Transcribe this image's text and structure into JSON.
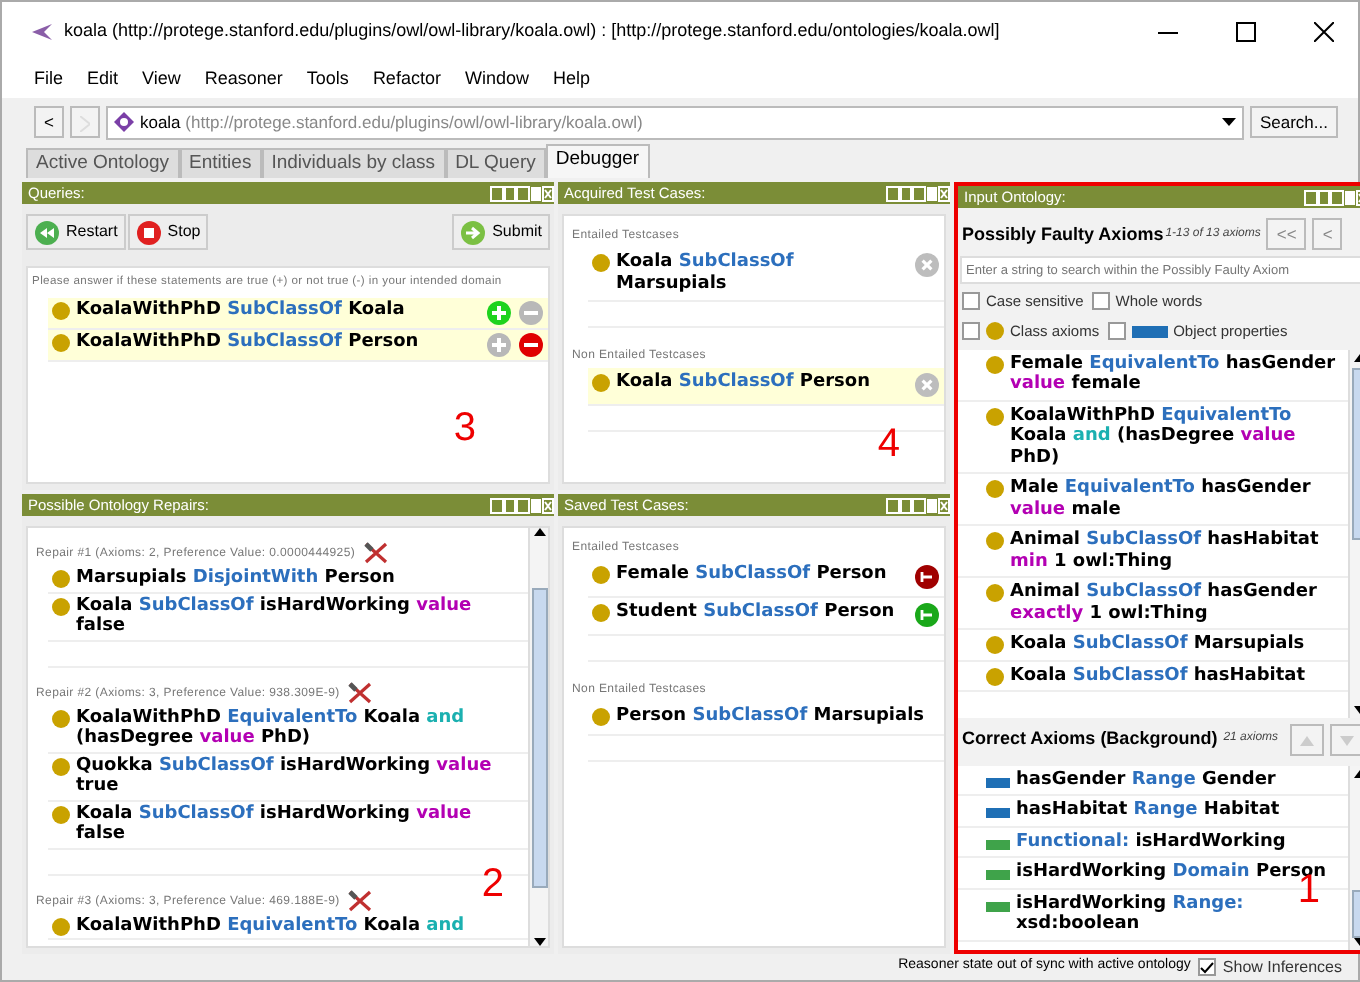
{
  "window": {
    "title": "koala (http://protege.stanford.edu/plugins/owl/owl-library/koala.owl)  : [http://protege.stanford.edu/ontologies/koala.owl]"
  },
  "menu": [
    "File",
    "Edit",
    "View",
    "Reasoner",
    "Tools",
    "Refactor",
    "Window",
    "Help"
  ],
  "address_bar": {
    "back": "<",
    "name": "koala",
    "iri": "(http://protege.stanford.edu/plugins/owl/owl-library/koala.owl)",
    "search_button": "Search..."
  },
  "tabs": [
    {
      "label": "Active Ontology",
      "selected": false
    },
    {
      "label": "Entities",
      "selected": false
    },
    {
      "label": "Individuals by class",
      "selected": false
    },
    {
      "label": "DL Query",
      "selected": false
    },
    {
      "label": "Debugger",
      "selected": true
    }
  ],
  "queries": {
    "title": "Queries:",
    "restart": "Restart",
    "stop": "Stop",
    "submit": "Submit",
    "instruction": "Please answer if these statements are true (+) or not true (-) in your intended domain",
    "annotation": "3",
    "items": [
      {
        "plus_on": true,
        "minus_on": false,
        "tokens": [
          {
            "text": "KoalaWithPhD",
            "kind": "name"
          },
          {
            "text": "SubClassOf",
            "kind": "keyword"
          },
          {
            "text": "Koala",
            "kind": "name"
          }
        ]
      },
      {
        "plus_on": false,
        "minus_on": true,
        "tokens": [
          {
            "text": "KoalaWithPhD",
            "kind": "name"
          },
          {
            "text": "SubClassOf",
            "kind": "keyword"
          },
          {
            "text": "Person",
            "kind": "name"
          }
        ]
      }
    ]
  },
  "repairs": {
    "title": "Possible Ontology Repairs:",
    "annotation": "2",
    "items": [
      {
        "header": "Repair #1 (Axioms: 2, Preference Value: 0.0000444925)",
        "axioms": [
          [
            {
              "text": "Marsupials",
              "kind": "name"
            },
            {
              "text": "DisjointWith",
              "kind": "keyword"
            },
            {
              "text": "Person",
              "kind": "name"
            }
          ],
          [
            {
              "text": "Koala",
              "kind": "name"
            },
            {
              "text": "SubClassOf",
              "kind": "keyword"
            },
            {
              "text": "isHardWorking",
              "kind": "name"
            },
            {
              "text": "value",
              "kind": "restriction"
            },
            {
              "text": "false",
              "kind": "name"
            }
          ]
        ]
      },
      {
        "header": "Repair #2 (Axioms: 3, Preference Value: 938.309E-9)",
        "axioms": [
          [
            {
              "text": "KoalaWithPhD",
              "kind": "name"
            },
            {
              "text": "EquivalentTo",
              "kind": "keyword"
            },
            {
              "text": "Koala",
              "kind": "name"
            },
            {
              "text": "and",
              "kind": "connective"
            },
            {
              "text": "(hasDegree",
              "kind": "name"
            },
            {
              "text": "value",
              "kind": "restriction"
            },
            {
              "text": "PhD)",
              "kind": "name"
            }
          ],
          [
            {
              "text": "Quokka",
              "kind": "name"
            },
            {
              "text": "SubClassOf",
              "kind": "keyword"
            },
            {
              "text": "isHardWorking",
              "kind": "name"
            },
            {
              "text": "value",
              "kind": "restriction"
            },
            {
              "text": "true",
              "kind": "name"
            }
          ],
          [
            {
              "text": "Koala",
              "kind": "name"
            },
            {
              "text": "SubClassOf",
              "kind": "keyword"
            },
            {
              "text": "isHardWorking",
              "kind": "name"
            },
            {
              "text": "value",
              "kind": "restriction"
            },
            {
              "text": "false",
              "kind": "name"
            }
          ]
        ]
      },
      {
        "header": "Repair #3 (Axioms: 3, Preference Value: 469.188E-9)",
        "axioms": [
          [
            {
              "text": "KoalaWithPhD",
              "kind": "name"
            },
            {
              "text": "EquivalentTo",
              "kind": "keyword"
            },
            {
              "text": "Koala",
              "kind": "name"
            },
            {
              "text": "and",
              "kind": "connective"
            }
          ]
        ]
      }
    ]
  },
  "acquired": {
    "title": "Acquired Test Cases:",
    "annotation": "4",
    "sections": [
      {
        "heading": "Entailed Testcases",
        "items": [
          {
            "highlighted": false,
            "tokens": [
              {
                "text": "Koala",
                "kind": "name"
              },
              {
                "text": "SubClassOf",
                "kind": "keyword"
              },
              {
                "text": "Marsupials",
                "kind": "name"
              }
            ]
          }
        ]
      },
      {
        "heading": "Non Entailed Testcases",
        "items": [
          {
            "highlighted": true,
            "tokens": [
              {
                "text": "Koala",
                "kind": "name"
              },
              {
                "text": "SubClassOf",
                "kind": "keyword"
              },
              {
                "text": "Person",
                "kind": "name"
              }
            ]
          }
        ]
      }
    ]
  },
  "saved": {
    "title": "Saved Test Cases:",
    "sections": [
      {
        "heading": "Entailed Testcases",
        "items": [
          {
            "color": "#a00000",
            "tokens": [
              {
                "text": "Female",
                "kind": "name"
              },
              {
                "text": "SubClassOf",
                "kind": "keyword"
              },
              {
                "text": "Person",
                "kind": "name"
              }
            ]
          },
          {
            "color": "#1aa81a",
            "tokens": [
              {
                "text": "Student",
                "kind": "name"
              },
              {
                "text": "SubClassOf",
                "kind": "keyword"
              },
              {
                "text": "Person",
                "kind": "name"
              }
            ]
          }
        ]
      },
      {
        "heading": "Non Entailed Testcases",
        "items": [
          {
            "tokens": [
              {
                "text": "Person",
                "kind": "name"
              },
              {
                "text": "SubClassOf",
                "kind": "keyword"
              },
              {
                "text": "Marsupials",
                "kind": "name"
              }
            ]
          }
        ]
      }
    ]
  },
  "input_ontology": {
    "title": "Input Ontology:",
    "annotation": "1",
    "faulty": {
      "title": "Possibly Faulty Axioms",
      "count": "1-13 of 13 axioms",
      "nav": [
        "<<",
        "<"
      ],
      "search_placeholder": "Enter a string to search within the Possibly Faulty Axiom",
      "options": [
        {
          "label": "Case sensitive",
          "checked": false
        },
        {
          "label": "Whole words",
          "checked": false
        }
      ],
      "filters": [
        {
          "label": "Class axioms",
          "checked": false,
          "kind": "class"
        },
        {
          "label": "Object properties",
          "checked": false,
          "kind": "object-property"
        }
      ],
      "axioms": [
        {
          "kind": "class",
          "tokens": [
            {
              "text": "Female",
              "kind": "name"
            },
            {
              "text": "EquivalentTo",
              "kind": "keyword"
            },
            {
              "text": "hasGender",
              "kind": "name"
            },
            {
              "text": "value",
              "kind": "restriction"
            },
            {
              "text": "female",
              "kind": "name"
            }
          ]
        },
        {
          "kind": "class",
          "tokens": [
            {
              "text": "KoalaWithPhD",
              "kind": "name"
            },
            {
              "text": "EquivalentTo",
              "kind": "keyword"
            },
            {
              "text": "Koala",
              "kind": "name"
            },
            {
              "text": "and",
              "kind": "connective"
            },
            {
              "text": "(hasDegree",
              "kind": "name"
            },
            {
              "text": "value",
              "kind": "restriction"
            },
            {
              "text": "PhD)",
              "kind": "name"
            }
          ]
        },
        {
          "kind": "class",
          "tokens": [
            {
              "text": "Male",
              "kind": "name"
            },
            {
              "text": "EquivalentTo",
              "kind": "keyword"
            },
            {
              "text": "hasGender",
              "kind": "name"
            },
            {
              "text": "value",
              "kind": "restriction"
            },
            {
              "text": "male",
              "kind": "name"
            }
          ]
        },
        {
          "kind": "class",
          "tokens": [
            {
              "text": "Animal",
              "kind": "name"
            },
            {
              "text": "SubClassOf",
              "kind": "keyword"
            },
            {
              "text": "hasHabitat",
              "kind": "name"
            },
            {
              "text": "min",
              "kind": "restriction"
            },
            {
              "text": "1 owl:Thing",
              "kind": "name"
            }
          ]
        },
        {
          "kind": "class",
          "tokens": [
            {
              "text": "Animal",
              "kind": "name"
            },
            {
              "text": "SubClassOf",
              "kind": "keyword"
            },
            {
              "text": "hasGender",
              "kind": "name"
            },
            {
              "text": "exactly",
              "kind": "restriction"
            },
            {
              "text": "1 owl:Thing",
              "kind": "name"
            }
          ]
        },
        {
          "kind": "class",
          "tokens": [
            {
              "text": "Koala",
              "kind": "name"
            },
            {
              "text": "SubClassOf",
              "kind": "keyword"
            },
            {
              "text": "Marsupials",
              "kind": "name"
            }
          ]
        },
        {
          "kind": "class",
          "tokens": [
            {
              "text": "Koala",
              "kind": "name"
            },
            {
              "text": "SubClassOf",
              "kind": "keyword"
            },
            {
              "text": "hasHabitat",
              "kind": "name"
            }
          ]
        }
      ]
    },
    "correct": {
      "title": "Correct Axioms (Background)",
      "count": "21 axioms",
      "axioms": [
        {
          "kind": "object-property",
          "tokens": [
            {
              "text": "hasGender",
              "kind": "name"
            },
            {
              "text": "Range",
              "kind": "keyword"
            },
            {
              "text": "Gender",
              "kind": "name"
            }
          ]
        },
        {
          "kind": "object-property",
          "tokens": [
            {
              "text": "hasHabitat",
              "kind": "name"
            },
            {
              "text": "Range",
              "kind": "keyword"
            },
            {
              "text": "Habitat",
              "kind": "name"
            }
          ]
        },
        {
          "kind": "data-property",
          "tokens": [
            {
              "text": "Functional:",
              "kind": "keyword"
            },
            {
              "text": "isHardWorking",
              "kind": "name"
            }
          ]
        },
        {
          "kind": "data-property",
          "tokens": [
            {
              "text": "isHardWorking",
              "kind": "name"
            },
            {
              "text": "Domain",
              "kind": "keyword"
            },
            {
              "text": "Person",
              "kind": "name"
            }
          ]
        },
        {
          "kind": "data-property",
          "tokens": [
            {
              "text": "isHardWorking",
              "kind": "name"
            },
            {
              "text": "Range:",
              "kind": "keyword"
            },
            {
              "text": "xsd:boolean",
              "kind": "name"
            }
          ]
        }
      ]
    }
  },
  "status_bar": {
    "message": "Reasoner state out of sync with active ontology",
    "show_inferences": {
      "label": "Show Inferences",
      "checked": true
    }
  }
}
